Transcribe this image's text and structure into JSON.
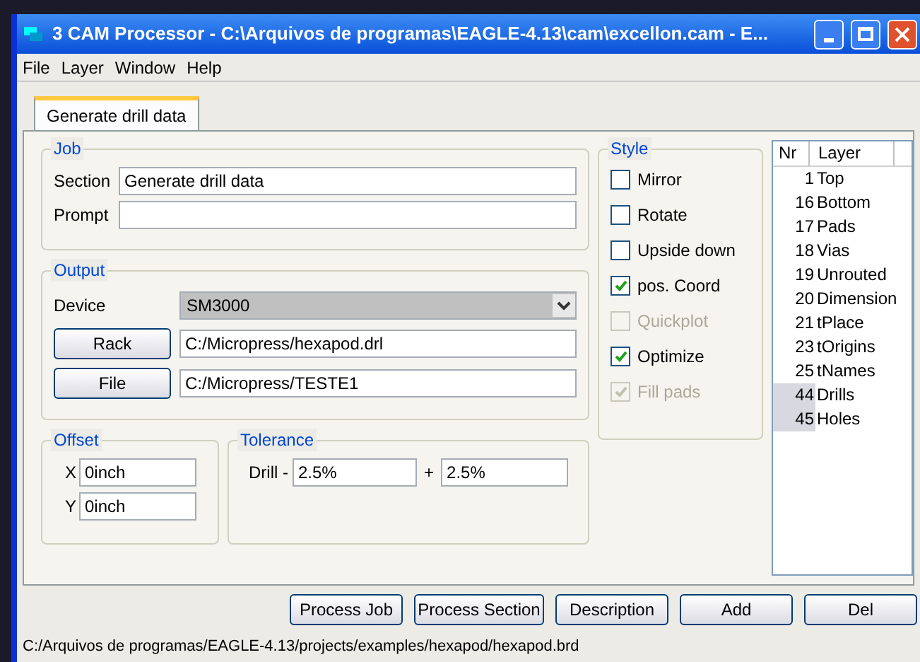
{
  "window": {
    "title": "3 CAM Processor - C:\\Arquivos de programas\\EAGLE-4.13\\cam\\excellon.cam - E..."
  },
  "menu": [
    "File",
    "Layer",
    "Window",
    "Help"
  ],
  "tabs": [
    {
      "label": "Generate drill data",
      "selected": true
    }
  ],
  "job": {
    "title": "Job",
    "section_label": "Section",
    "section_value": "Generate drill data",
    "prompt_label": "Prompt"
  },
  "output": {
    "title": "Output",
    "device_label": "Device",
    "device_value": "SM3000",
    "rack_button": "Rack",
    "rack_value": "C:/Micropress/hexapod.drl",
    "file_button": "File",
    "file_value": "C:/Micropress/TESTE1"
  },
  "offset": {
    "title": "Offset",
    "x_label": "X",
    "x_value": "0inch",
    "y_label": "Y",
    "y_value": "0inch"
  },
  "tolerance": {
    "title": "Tolerance",
    "drill_label": "Drill -",
    "minus_value": "2.5%",
    "plus_label": "+",
    "plus_value": "2.5%"
  },
  "style": {
    "title": "Style",
    "options": [
      {
        "label": "Mirror",
        "checked": false,
        "disabled": false
      },
      {
        "label": "Rotate",
        "checked": false,
        "disabled": false
      },
      {
        "label": "Upside down",
        "checked": false,
        "disabled": false
      },
      {
        "label": "pos. Coord",
        "checked": true,
        "disabled": false
      },
      {
        "label": "Quickplot",
        "checked": false,
        "disabled": true
      },
      {
        "label": "Optimize",
        "checked": true,
        "disabled": false
      },
      {
        "label": "Fill pads",
        "checked": true,
        "disabled": true
      }
    ]
  },
  "layers": {
    "columns": [
      "Nr",
      "Layer"
    ],
    "rows": [
      {
        "nr": "1",
        "name": "Top",
        "selected": false
      },
      {
        "nr": "16",
        "name": "Bottom",
        "selected": false
      },
      {
        "nr": "17",
        "name": "Pads",
        "selected": false
      },
      {
        "nr": "18",
        "name": "Vias",
        "selected": false
      },
      {
        "nr": "19",
        "name": "Unrouted",
        "selected": false
      },
      {
        "nr": "20",
        "name": "Dimension",
        "selected": false
      },
      {
        "nr": "21",
        "name": "tPlace",
        "selected": false
      },
      {
        "nr": "23",
        "name": "tOrigins",
        "selected": false
      },
      {
        "nr": "25",
        "name": "tNames",
        "selected": false
      },
      {
        "nr": "44",
        "name": "Drills",
        "selected": true
      },
      {
        "nr": "45",
        "name": "Holes",
        "selected": true
      }
    ]
  },
  "buttons": [
    "Process Job",
    "Process Section",
    "Description",
    "Add",
    "Del"
  ],
  "status_bar": "C:/Arquivos de programas/EAGLE-4.13/projects/examples/hexapod/hexapod.brd"
}
